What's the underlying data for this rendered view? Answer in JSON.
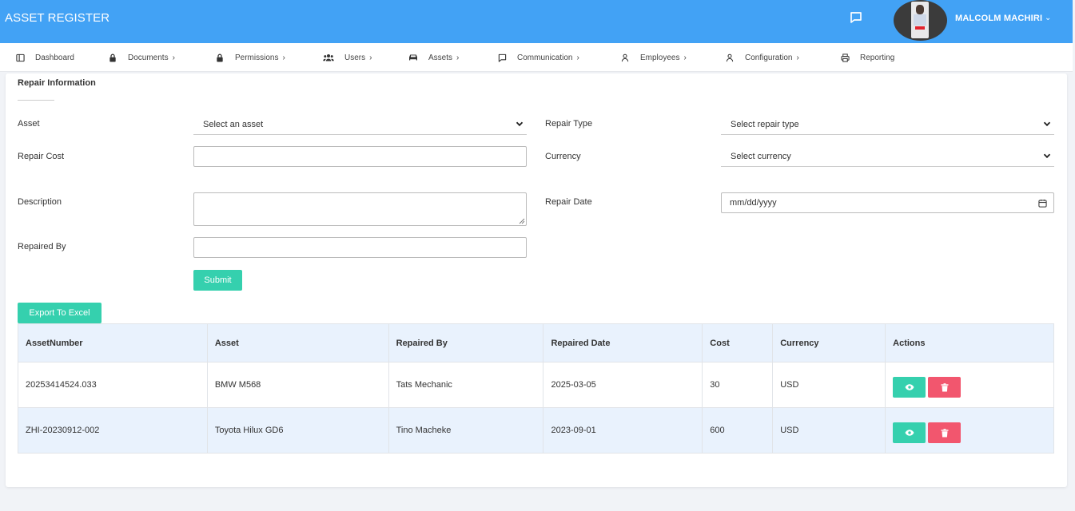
{
  "app": {
    "title": "ASSET REGISTER"
  },
  "user": {
    "name": "MALCOLM MACHIRI"
  },
  "nav": [
    {
      "label": "Dashboard",
      "icon": "sidebar-icon",
      "chevron": ""
    },
    {
      "label": "Documents",
      "icon": "lock-icon",
      "chevron": "›"
    },
    {
      "label": "Permissions",
      "icon": "lock-icon",
      "chevron": "›"
    },
    {
      "label": "Users",
      "icon": "users-icon",
      "chevron": "›"
    },
    {
      "label": "Assets",
      "icon": "car-icon",
      "chevron": "›"
    },
    {
      "label": "Communication",
      "icon": "message-icon",
      "chevron": "›"
    },
    {
      "label": "Employees",
      "icon": "user-icon",
      "chevron": "›"
    },
    {
      "label": "Configuration",
      "icon": "user-icon",
      "chevron": "›"
    },
    {
      "label": "Reporting",
      "icon": "printer-icon",
      "chevron": ""
    }
  ],
  "form": {
    "title": "Repair Information",
    "asset_label": "Asset",
    "asset_value": "Select an asset",
    "repair_type_label": "Repair Type",
    "repair_type_value": "Select repair type",
    "repair_cost_label": "Repair Cost",
    "repair_cost_value": "",
    "currency_label": "Currency",
    "currency_value": "Select currency",
    "description_label": "Description",
    "repair_date_label": "Repair Date",
    "repair_date_value": "mm/dd/yyyy",
    "repaired_by_label": "Repaired By",
    "repaired_by_value": "",
    "submit_label": "Submit"
  },
  "export_label": "Export To Excel",
  "table": {
    "headers": [
      "AssetNumber",
      "Asset",
      "Repaired By",
      "Repaired Date",
      "Cost",
      "Currency",
      "Actions"
    ],
    "rows": [
      [
        "20253414524.033",
        "BMW M568",
        "Tats Mechanic",
        "2025-03-05",
        "30",
        "USD"
      ],
      [
        "ZHI-20230912-002",
        "Toyota Hilux GD6",
        "Tino Macheke",
        "2023-09-01",
        "600",
        "USD"
      ]
    ]
  },
  "colors": {
    "topbar": "#42a2f5",
    "teal": "#35d0ae",
    "danger": "#f2566e",
    "row_alt": "#e9f2fd"
  }
}
